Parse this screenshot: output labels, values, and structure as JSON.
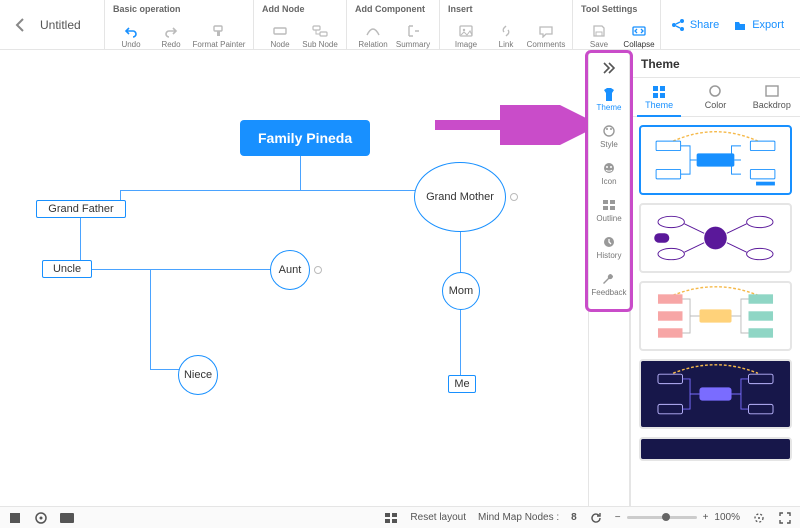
{
  "doc": {
    "title": "Untitled"
  },
  "toolbar": {
    "groups": {
      "basic": {
        "title": "Basic operation",
        "undo": "Undo",
        "redo": "Redo",
        "format": "Format Painter"
      },
      "addNode": {
        "title": "Add Node",
        "node": "Node",
        "sub": "Sub Node"
      },
      "addComp": {
        "title": "Add Component",
        "relation": "Relation",
        "summary": "Summary"
      },
      "insert": {
        "title": "Insert",
        "image": "Image",
        "link": "Link",
        "comments": "Comments"
      },
      "tool": {
        "title": "Tool Settings",
        "save": "Save",
        "collapse": "Collapse"
      }
    },
    "share": "Share",
    "export": "Export"
  },
  "mindmap": {
    "root": "Family Pineda",
    "grandFather": "Grand Father",
    "grandMother": "Grand Mother",
    "uncle": "Uncle",
    "aunt": "Aunt",
    "niece": "Niece",
    "mom": "Mom",
    "me": "Me"
  },
  "rail": {
    "theme": "Theme",
    "style": "Style",
    "icon": "Icon",
    "outline": "Outline",
    "history": "History",
    "feedback": "Feedback"
  },
  "sidebar": {
    "title": "Theme",
    "tabs": {
      "theme": "Theme",
      "color": "Color",
      "backdrop": "Backdrop"
    }
  },
  "status": {
    "reset": "Reset layout",
    "nodesLabel": "Mind Map Nodes :",
    "nodes": "8",
    "zoom": "100%"
  }
}
